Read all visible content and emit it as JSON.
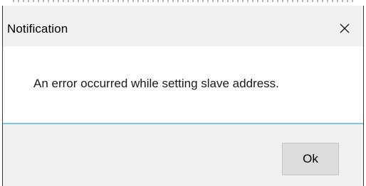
{
  "dialog": {
    "title": "Notification",
    "close_icon": "close-icon",
    "message": "An error occurred while setting slave address.",
    "ok_label": "Ok"
  },
  "colors": {
    "title_bar": "#f0f0f0",
    "message_background": "#ffffff",
    "separator_accent": "#7cc4e8",
    "button_background": "#dcdcdc",
    "window_border": "#3a3a3a"
  }
}
